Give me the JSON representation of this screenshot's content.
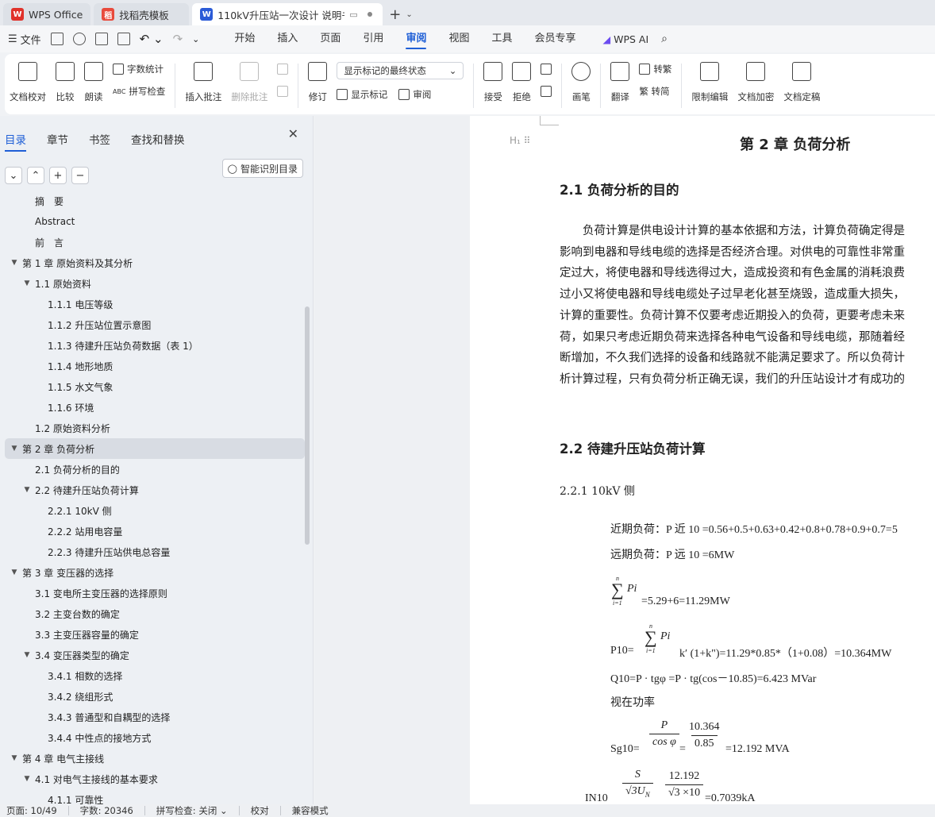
{
  "tabs": [
    {
      "label": "WPS Office",
      "active": false
    },
    {
      "label": "找稻壳模板",
      "active": false
    },
    {
      "label": "110kV升压站一次设计 说明书",
      "active": true
    }
  ],
  "menu": {
    "file_label": "文件",
    "tabs": [
      "开始",
      "插入",
      "页面",
      "引用",
      "审阅",
      "视图",
      "工具",
      "会员专享"
    ],
    "active_tab": "审阅",
    "wps_ai": "WPS AI"
  },
  "ribbon": {
    "doc_check": "文档校对",
    "compare": "比较",
    "read_aloud": "朗读",
    "word_count": "字数统计",
    "spell_check": "拼写检查",
    "insert_comment": "插入批注",
    "delete_comment": "删除批注",
    "revise": "修订",
    "markup_dropdown": "显示标记的最终状态",
    "show_markup": "显示标记",
    "review": "审阅",
    "accept": "接受",
    "reject": "拒绝",
    "pen": "画笔",
    "translate": "翻译",
    "to_traditional": "转繁",
    "to_simplified": "繁 转简",
    "restrict_edit": "限制编辑",
    "encrypt": "文档加密",
    "finalize": "文档定稿"
  },
  "panel": {
    "tabs": [
      "目录",
      "章节",
      "书签",
      "查找和替换"
    ],
    "active_tab": "目录",
    "smart_button": "智能识别目录",
    "toc": [
      {
        "label": "摘　要",
        "level": 1,
        "arrow": false
      },
      {
        "label": "Abstract",
        "level": 1,
        "arrow": false
      },
      {
        "label": "前　言",
        "level": 1,
        "arrow": false
      },
      {
        "label": "第 1 章  原始资料及其分析",
        "level": 0,
        "arrow": true
      },
      {
        "label": "1.1 原始资料",
        "level": 1,
        "arrow": true
      },
      {
        "label": "1.1.1 电压等级",
        "level": 2,
        "arrow": false
      },
      {
        "label": "1.1.2 升压站位置示意图",
        "level": 2,
        "arrow": false
      },
      {
        "label": "1.1.3 待建升压站负荷数据（表 1）",
        "level": 2,
        "arrow": false
      },
      {
        "label": "1.1.4 地形地质",
        "level": 2,
        "arrow": false
      },
      {
        "label": "1.1.5 水文气象",
        "level": 2,
        "arrow": false
      },
      {
        "label": "1.1.6 环境",
        "level": 2,
        "arrow": false
      },
      {
        "label": "1.2 原始资料分析",
        "level": 1,
        "arrow": false
      },
      {
        "label": "第 2 章  负荷分析",
        "level": 0,
        "arrow": true,
        "selected": true
      },
      {
        "label": "2.1 负荷分析的目的",
        "level": 1,
        "arrow": false
      },
      {
        "label": "2.2 待建升压站负荷计算",
        "level": 1,
        "arrow": true
      },
      {
        "label": "2.2.1 10kV  侧",
        "level": 2,
        "arrow": false
      },
      {
        "label": "2.2.2 站用电容量",
        "level": 2,
        "arrow": false
      },
      {
        "label": "2.2.3 待建升压站供电总容量",
        "level": 2,
        "arrow": false
      },
      {
        "label": "第 3 章  变压器的选择",
        "level": 0,
        "arrow": true
      },
      {
        "label": "3.1 变电所主变压器的选择原则",
        "level": 1,
        "arrow": false
      },
      {
        "label": "3.2 主变台数的确定",
        "level": 1,
        "arrow": false
      },
      {
        "label": "3.3 主变压器容量的确定",
        "level": 1,
        "arrow": false
      },
      {
        "label": "3.4  变压器类型的确定",
        "level": 1,
        "arrow": true
      },
      {
        "label": "3.4.1 相数的选择",
        "level": 2,
        "arrow": false
      },
      {
        "label": "3.4.2  绕组形式",
        "level": 2,
        "arrow": false
      },
      {
        "label": "3.4.3  普通型和自耦型的选择",
        "level": 2,
        "arrow": false
      },
      {
        "label": "3.4.4  中性点的接地方式",
        "level": 2,
        "arrow": false
      },
      {
        "label": "第 4 章  电气主接线",
        "level": 0,
        "arrow": true
      },
      {
        "label": "4.1 对电气主接线的基本要求",
        "level": 1,
        "arrow": true
      },
      {
        "label": "4.1.1 可靠性",
        "level": 2,
        "arrow": false
      }
    ]
  },
  "document": {
    "heading_marker": "H₁",
    "chapter_title": "第 2 章  负荷分析",
    "sec1_title": "2.1 负荷分析的目的",
    "paragraph": [
      "　　负荷计算是供电设计计算的基本依据和方法，计算负荷确定得是",
      "影响到电器和导线电缆的选择是否经济合理。对供电的可靠性非常重",
      "定过大，将使电器和导线选得过大，造成投资和有色金属的消耗浪费",
      "过小又将使电器和导线电缆处子过早老化甚至烧毁，造成重大损失，",
      "计算的重要性。负荷计算不仅要考虑近期投入的负荷，更要考虑未来",
      "荷，如果只考虑近期负荷来选择各种电气设备和导线电缆，那随着经",
      "断增加，不久我们选择的设备和线路就不能满足要求了。所以负荷计",
      "析计算过程，只有负荷分析正确无误，我们的升压站设计才有成功的"
    ],
    "sec2_title": "2.2 待建升压站负荷计算",
    "sub_title": "2.2.1 10kV  侧",
    "eq_near": "近期负荷：P 近 10 =0.56+0.5+0.63+0.42+0.8+0.78+0.9+0.7=5",
    "eq_far": "远期负荷：P 远 10 =6MW",
    "sum_symbol": "∑",
    "sum_var": "Pi",
    "sum_top": "n",
    "sum_bottom": "i=1",
    "eq_sum": "=5.29+6=11.29MW",
    "eq_p10_prefix": "P10=",
    "eq_p10_rest": "k′ (1+k\")=11.29*0.85*（1+0.08）=10.364MW",
    "eq_q10": "Q10=P · tgφ =P · tg(cos－10.85)=6.423 MVar",
    "eq_apparent": "视在功率",
    "sg_prefix": "Sg10=",
    "sg_frac1_num": "P",
    "sg_frac1_den": "cos φ",
    "sg_eq": "=",
    "sg_frac2_num": "10.364",
    "sg_frac2_den": "0.85",
    "sg_result": "=12.192 MVA",
    "in_prefix": "IN10",
    "in_frac1_num": "S",
    "in_frac1_den": "√3U",
    "in_frac1_den_sub": "N",
    "in_frac2_num": "12.192",
    "in_frac2_den": "√3 ×10",
    "in_result": "=0.7039kA"
  },
  "status": {
    "page": "页面: 10/49",
    "words": "字数: 20346",
    "spell": "拼写检查: 关闭",
    "proof": "校对",
    "compat": "兼容模式"
  },
  "colors": {
    "accent": "#1f5fd6",
    "wps_red": "#e0322b",
    "doc_blue": "#2b5bd7"
  }
}
